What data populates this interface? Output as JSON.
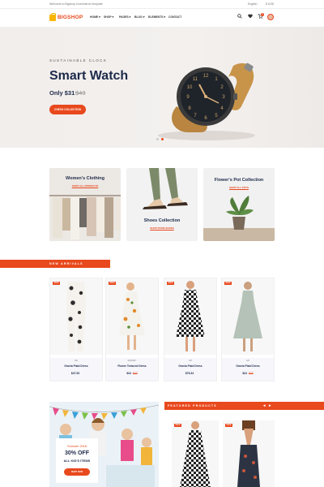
{
  "topbar": {
    "welcome": "Welcome to Bigshop ecommerce template",
    "language": "English",
    "currency": "$ USD"
  },
  "brand": {
    "name": "BIGSHOP",
    "accent": "#e8491d",
    "logo_color": "#f7b500"
  },
  "menu": [
    "HOME ▾",
    "SHOP ▾",
    "PAGES ▾",
    "BLOG ▾",
    "ELEMENTS ▾",
    "CONTACT"
  ],
  "icons": {
    "search": "search-icon",
    "wishlist": "heart-icon",
    "cart": "cart-icon",
    "cart_count": "0"
  },
  "hero": {
    "kicker": "SUSTAINABLE CLOCK",
    "title": "Smart Watch",
    "price": "Only $31",
    "old_price": "$43",
    "button": "CHECK COLLECTION",
    "slides": 2,
    "active_slide": 2
  },
  "categories": [
    {
      "title": "Women's Clothing",
      "link": "SHOP ALL PRODUCTS"
    },
    {
      "title": "Shoes Collection",
      "link": "SHOP FROM SHOES"
    },
    {
      "title": "Flower's Pot Collection",
      "link": "SHOP ALL POTS"
    }
  ],
  "new_arrivals": {
    "heading": "NEW ARRIVALS",
    "products": [
      {
        "badge": "SALE",
        "brand": "LBI",
        "name": "Gravia Plaid Dress",
        "price": "$47.53",
        "old_price": ""
      },
      {
        "badge": "SALE",
        "brand": "BARNEY",
        "name": "Flower Textured Dress",
        "price": "$24",
        "old_price": "$33"
      },
      {
        "badge": "SALE",
        "brand": "LBI",
        "name": "Gravia Plaid Dress",
        "price": "$78.34",
        "old_price": ""
      },
      {
        "badge": "SALE",
        "brand": "LBI",
        "name": "Gravia Plaid Dress",
        "price": "$24",
        "old_price": "$33"
      }
    ]
  },
  "kids_promo": {
    "season": "Summer 2018",
    "offer": "30% OFF",
    "subtitle": "ALL KID'S ITEMS",
    "button": "SHOP NOW"
  },
  "featured": {
    "heading": "FEATURED PRODUCTS",
    "prev": "◂",
    "next": "▸",
    "badges": [
      "SALE",
      "SALE"
    ]
  }
}
